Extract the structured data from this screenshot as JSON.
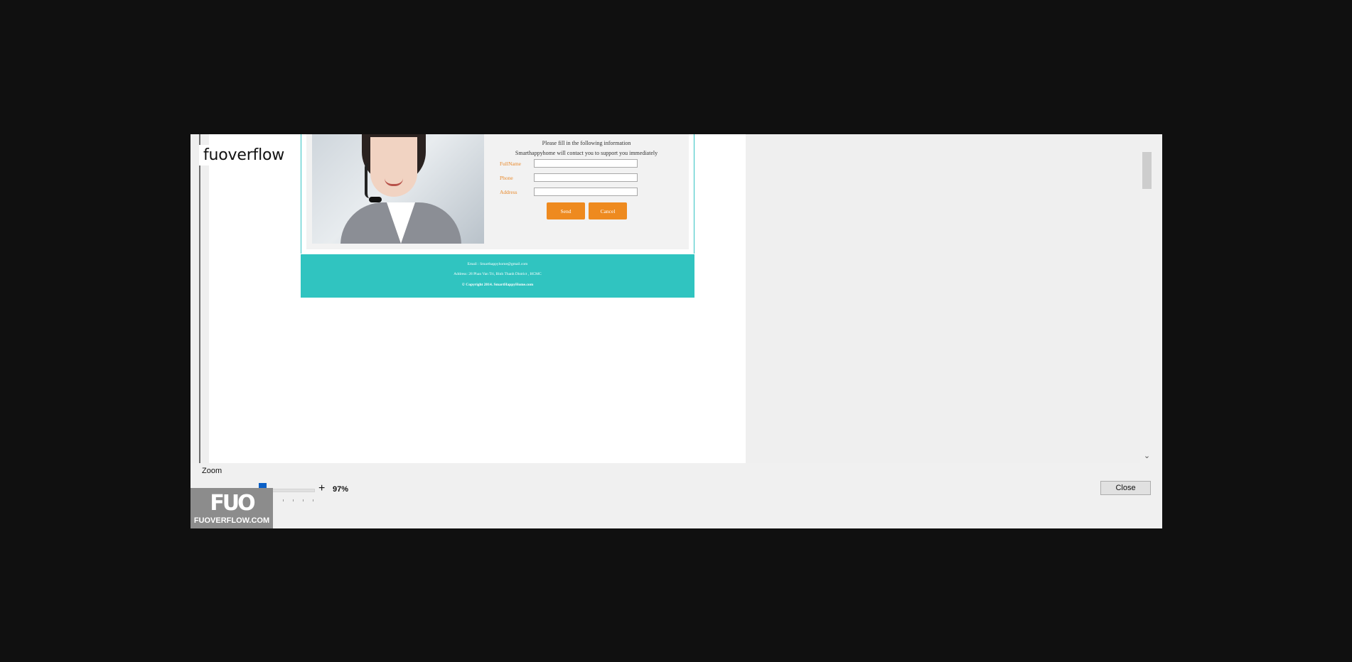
{
  "watermark_top": "fuoverflow",
  "form": {
    "intro_line1": "Please fill in the following information",
    "intro_line2": "Smarthappyhome will contact you to support you immediately",
    "fields": [
      {
        "label": "FullName",
        "value": ""
      },
      {
        "label": "Phone",
        "value": ""
      },
      {
        "label": "Address",
        "value": ""
      }
    ],
    "send_label": "Send",
    "cancel_label": "Cancel"
  },
  "footer": {
    "email": "Email : Smarthappyhome@gmail.com",
    "address": "Address: 28 Phan Van Tri, Binh Thanh District , HCMC",
    "copyright": "© Copyright 2014. SmartHappyHome.com"
  },
  "zoom": {
    "label": "Zoom",
    "minus": "-",
    "plus": "+",
    "value_text": "97%",
    "level_percent": 97
  },
  "close_label": "Close",
  "logo": {
    "mark": "FUO",
    "url": "FUOVERFLOW.COM"
  },
  "colors": {
    "accent_orange": "#ee8a1f",
    "footer_teal": "#30c4c0",
    "zoom_thumb": "#0a5fc6"
  }
}
